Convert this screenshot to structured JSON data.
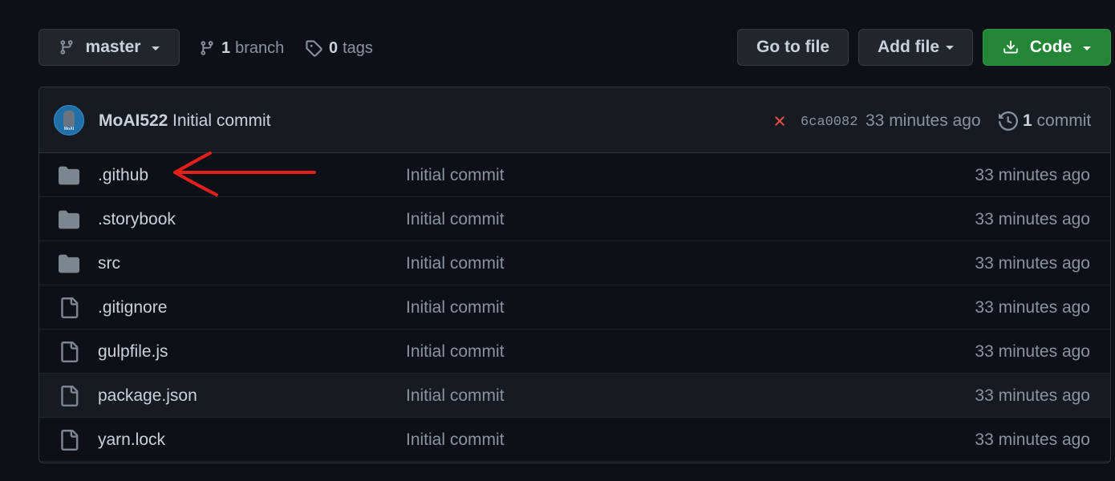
{
  "branch_button": {
    "label": "master",
    "icon": "git-branch-icon"
  },
  "branches": {
    "count": "1",
    "label": "branch"
  },
  "tags": {
    "count": "0",
    "label": "tags"
  },
  "buttons": {
    "go_to_file": "Go to file",
    "add_file": "Add file",
    "code": "Code"
  },
  "latest_commit": {
    "author": "MoAI522",
    "message": "Initial commit",
    "status": "failed",
    "sha": "6ca0082",
    "time": "33 minutes ago",
    "commit_count": "1",
    "commit_label": "commit",
    "avatar_text": "MoAI"
  },
  "files": [
    {
      "name": ".github",
      "type": "folder",
      "message": "Initial commit",
      "time": "33 minutes ago"
    },
    {
      "name": ".storybook",
      "type": "folder",
      "message": "Initial commit",
      "time": "33 minutes ago"
    },
    {
      "name": "src",
      "type": "folder",
      "message": "Initial commit",
      "time": "33 minutes ago"
    },
    {
      "name": ".gitignore",
      "type": "file",
      "message": "Initial commit",
      "time": "33 minutes ago"
    },
    {
      "name": "gulpfile.js",
      "type": "file",
      "message": "Initial commit",
      "time": "33 minutes ago"
    },
    {
      "name": "package.json",
      "type": "file",
      "message": "Initial commit",
      "time": "33 minutes ago"
    },
    {
      "name": "yarn.lock",
      "type": "file",
      "message": "Initial commit",
      "time": "33 minutes ago"
    }
  ],
  "colors": {
    "background": "#0d1117",
    "code_button": "#238636",
    "annotation_arrow": "#e5201c",
    "failed_status": "#f85149"
  }
}
